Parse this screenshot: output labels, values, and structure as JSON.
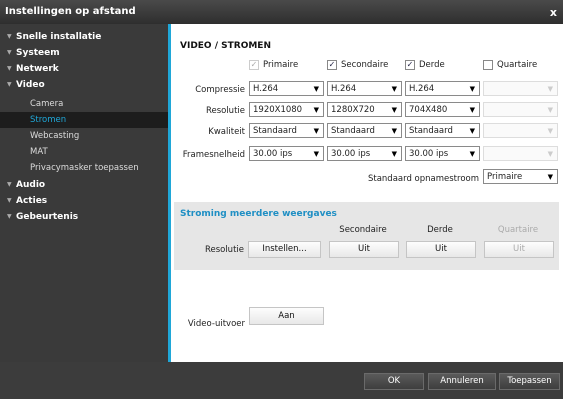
{
  "window": {
    "title": "Instellingen op afstand",
    "close": "x"
  },
  "sidebar": {
    "top_items": [
      {
        "label": "Snelle installatie"
      },
      {
        "label": "Systeem"
      },
      {
        "label": "Netwerk"
      },
      {
        "label": "Video"
      }
    ],
    "video_sub_items": [
      {
        "label": "Camera"
      },
      {
        "label": "Stromen",
        "selected": true
      },
      {
        "label": "Webcasting"
      },
      {
        "label": "MAT"
      },
      {
        "label": "Privacymasker toepassen"
      }
    ],
    "bottom_items": [
      {
        "label": "Audio"
      },
      {
        "label": "Acties"
      },
      {
        "label": "Gebeurtenis"
      }
    ]
  },
  "main": {
    "section_title": "VIDEO / STROMEN",
    "streams": [
      {
        "label": "Primaire",
        "checked": true,
        "enabled": false
      },
      {
        "label": "Secondaire",
        "checked": true,
        "enabled": true
      },
      {
        "label": "Derde",
        "checked": true,
        "enabled": true
      },
      {
        "label": "Quartaire",
        "checked": false,
        "enabled": true
      }
    ],
    "rows": {
      "compression": {
        "label": "Compressie",
        "values": [
          "H.264",
          "H.264",
          "H.264",
          ""
        ]
      },
      "resolution": {
        "label": "Resolutie",
        "values": [
          "1920X1080",
          "1280X720",
          "704X480",
          ""
        ]
      },
      "quality": {
        "label": "Kwaliteit",
        "values": [
          "Standaard",
          "Standaard",
          "Standaard",
          ""
        ]
      },
      "framerate": {
        "label": "Framesnelheid",
        "values": [
          "30.00 ips",
          "30.00 ips",
          "30.00 ips",
          ""
        ]
      }
    },
    "default_record_stream": {
      "label": "Standaard opnamestroom",
      "value": "Primaire"
    },
    "multi_view": {
      "title": "Stroming meerdere weergaves",
      "columns": [
        "Secondaire",
        "Derde",
        "Quartaire"
      ],
      "row_label": "Resolutie",
      "setup_button": "Instellen...",
      "values": [
        "Uit",
        "Uit",
        "Uit"
      ]
    },
    "video_output": {
      "label": "Video-uitvoer",
      "value": "Aan"
    }
  },
  "footer": {
    "ok": "OK",
    "cancel": "Annuleren",
    "apply": "Toepassen"
  },
  "colors": {
    "accent": "#1fa7d8",
    "sidebar_bg": "#3a3a3a",
    "panel_bg": "#e6e6e6"
  }
}
